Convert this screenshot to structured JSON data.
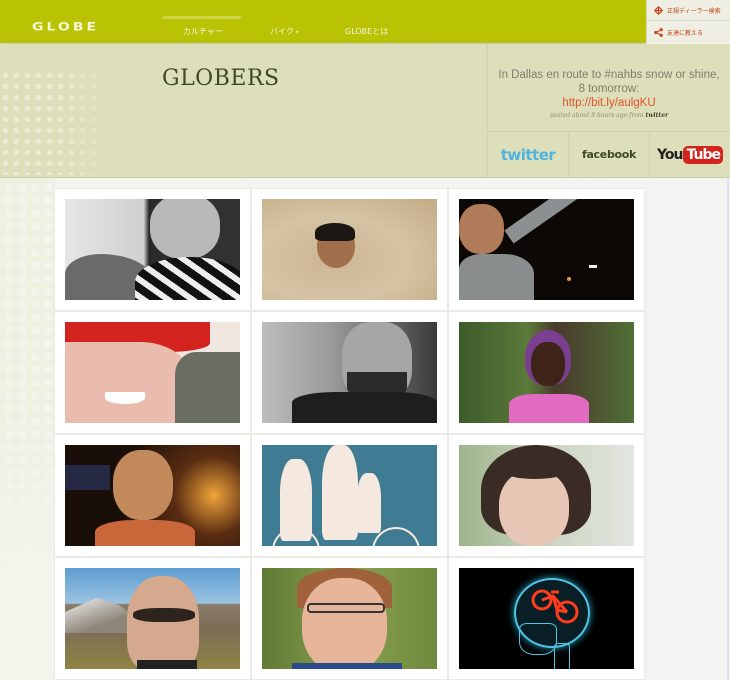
{
  "brand": {
    "logo_text": "GLOBE"
  },
  "nav": {
    "items": [
      {
        "label": "カルチャー",
        "active": true
      },
      {
        "label": "バイク",
        "has_dropdown": true,
        "caret": "▾"
      },
      {
        "label": "GLOBEとは"
      }
    ]
  },
  "utility_links": [
    {
      "label": "正規ディーラー検索",
      "icon": "crosshair-icon"
    },
    {
      "label": "友達に教える",
      "icon": "share-icon"
    }
  ],
  "header": {
    "title": "GLOBERS"
  },
  "tweet": {
    "text": "In Dallas en route to #nahbs snow or shine, 8 tomorrow:",
    "link": "http://bit.ly/aulgKU",
    "meta_prefix": "posted about 8 hours ago from",
    "meta_source": "twitter"
  },
  "social": {
    "twitter": "twitter",
    "facebook": "facebook",
    "youtube_you": "You",
    "youtube_tube": "Tube"
  },
  "colors": {
    "nav_bg": "#b9c203",
    "header_bg": "#dcdfba",
    "link": "#e0532c",
    "title": "#3e4a22"
  },
  "globers": [
    {
      "name": "glober-1",
      "description": "black-and-white portrait of woman resting chin on bicycle helmet"
    },
    {
      "name": "glober-2",
      "description": "man buried in sand up to his head"
    },
    {
      "name": "glober-3",
      "description": "man with glasses waving at night"
    },
    {
      "name": "glober-4",
      "description": "smiling woman in red beanie"
    },
    {
      "name": "glober-5",
      "description": "black-and-white portrait of bearded man"
    },
    {
      "name": "glober-6",
      "description": "woman with purple hair in forest"
    },
    {
      "name": "glober-7",
      "description": "man with glasses in warm indoor light"
    },
    {
      "name": "glober-8",
      "description": "illustrated family silhouette on bicycle"
    },
    {
      "name": "glober-9",
      "description": "woman with bangs portrait"
    },
    {
      "name": "glober-10",
      "description": "woman with sunglasses in mountains"
    },
    {
      "name": "glober-11",
      "description": "smiling woman with glasses outdoors"
    },
    {
      "name": "glober-12",
      "description": "x-ray skull with bicycle in brain"
    }
  ]
}
